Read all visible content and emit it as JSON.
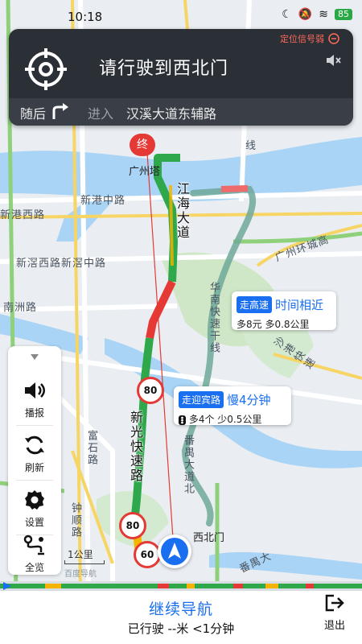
{
  "status_bar": {
    "time": "10:18",
    "battery": "85"
  },
  "nav_card": {
    "signal_warning": "定位信号弱",
    "instruction": "请行驶到西北门",
    "then_label": "随后",
    "enter_label": "进入",
    "road_name": "汉溪大道东辅路"
  },
  "side_panel": {
    "items": [
      {
        "label": "播报",
        "icon": "speaker-icon"
      },
      {
        "label": "刷新",
        "icon": "refresh-icon"
      },
      {
        "label": "设置",
        "icon": "gear-icon"
      },
      {
        "label": "全览",
        "icon": "route-overview-icon"
      }
    ]
  },
  "bubbles": {
    "highway": {
      "tag": "走高速",
      "headline": "时间相近",
      "detail": "多8元 多0.8公里"
    },
    "yingbin": {
      "tag": "走迎宾路",
      "headline": "慢4分钟",
      "detail": "多4个 少0.5公里"
    }
  },
  "map": {
    "end_pin": "终",
    "destination": "广州塔",
    "current_gate": "西北门",
    "labels": {
      "xingang_road": "新港中路",
      "xingang_west": "新港西路",
      "nanzhou": "南洲路",
      "xinjiao": "新滘西路新滘中路",
      "guangzhou_ring": "广州环城高",
      "shagang": "沙港快速",
      "yanjiang": "江海大道",
      "xinguang": "新光快速路",
      "huanan": "华南快速干线",
      "fanyu_dadao": "番禺大道北",
      "fushi": "富石路",
      "zhongshun": "钟顺路",
      "fanyu_bottom": "番禺大",
      "xian": "线",
      "west_road": "西路",
      "huancheng": "环城",
      "yingbin_label": "路"
    },
    "speed_limits": [
      "80",
      "80",
      "60"
    ],
    "scale": "1公里",
    "watermark": "百度导航"
  },
  "bottom_bar": {
    "continue": "继续导航",
    "stats": "已行驶 --米 <1分钟",
    "exit": "退出"
  },
  "colors": {
    "accent": "#1a6ef0",
    "congestion": "#e53935",
    "clear": "#2ea84b",
    "slow": "#f5b400"
  }
}
